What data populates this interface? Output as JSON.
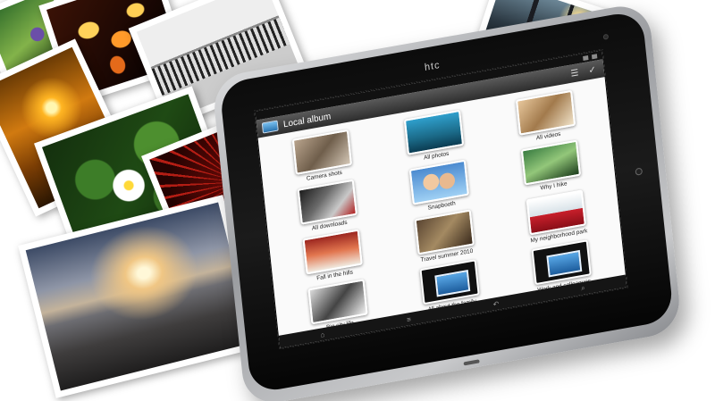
{
  "device": {
    "brand": "htc"
  },
  "photos": [
    {
      "subject": "flowers"
    },
    {
      "subject": "lanterns"
    },
    {
      "subject": "building"
    },
    {
      "subject": "sunset"
    },
    {
      "subject": "lotus"
    },
    {
      "subject": "fireworks"
    },
    {
      "subject": "beach"
    },
    {
      "subject": "trees"
    }
  ],
  "app": {
    "title": "Local album",
    "header_icons": [
      "album-icon",
      "menu-icon",
      "check-icon"
    ],
    "albums": [
      {
        "label": "Camera shots"
      },
      {
        "label": "All photos"
      },
      {
        "label": "All videos"
      },
      {
        "label": "All downloads"
      },
      {
        "label": "Snapbooth"
      },
      {
        "label": "Why I hike"
      },
      {
        "label": "Fall in the hills"
      },
      {
        "label": "Travel summer 2010"
      },
      {
        "label": "My neighborhood park"
      },
      {
        "label": "Big city life"
      },
      {
        "label": "All about the family"
      },
      {
        "label": "Work and colleagues"
      }
    ]
  },
  "nav": {
    "icons": [
      "home-icon",
      "menu-icon",
      "back-icon",
      "search-icon"
    ],
    "glyphs": [
      "⌂",
      "≡",
      "↶",
      "⌕"
    ]
  }
}
